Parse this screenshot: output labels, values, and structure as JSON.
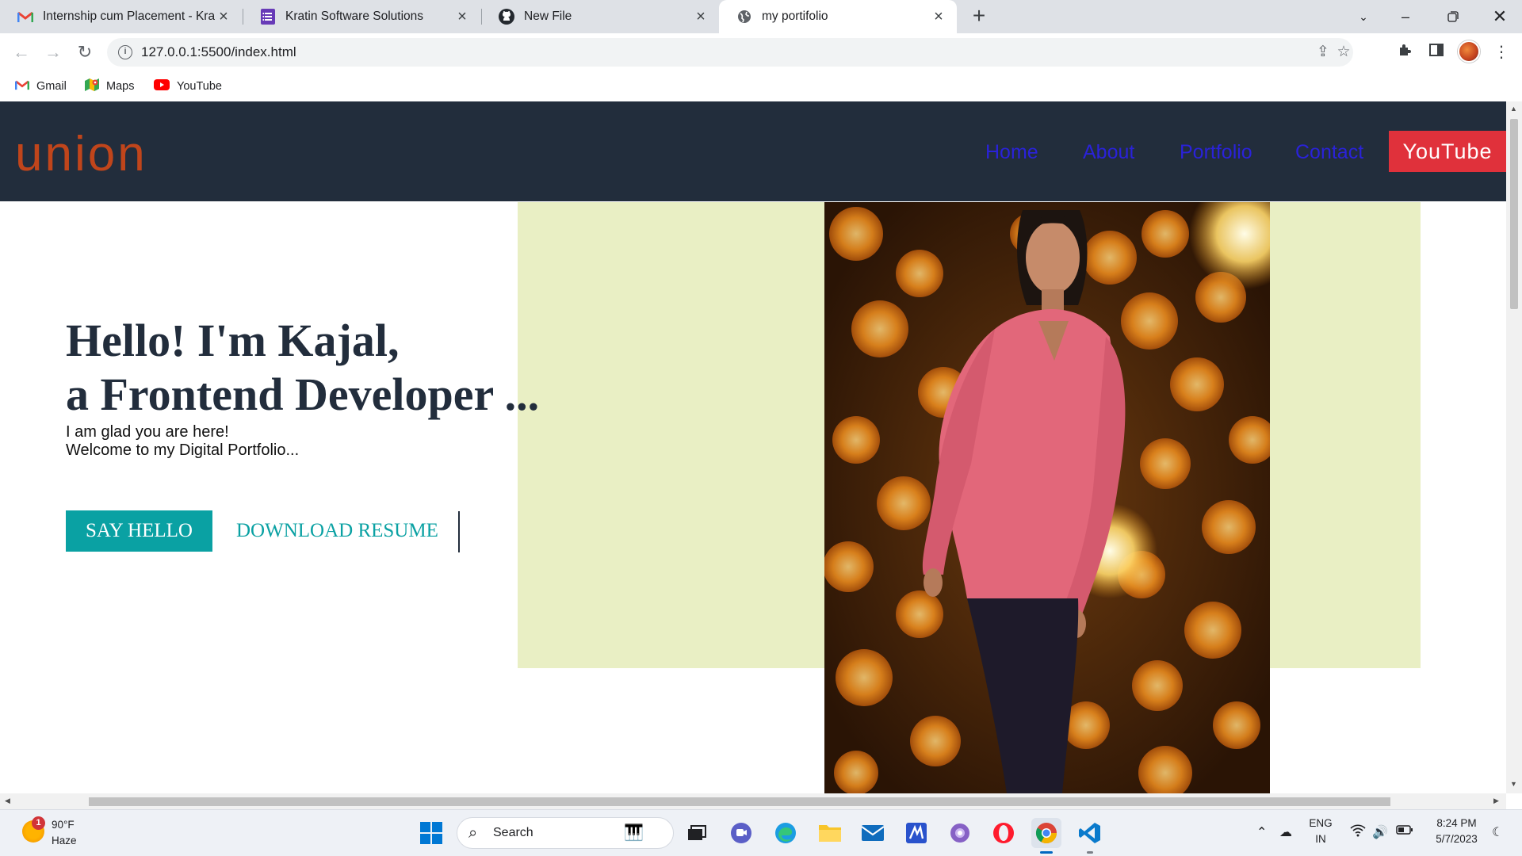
{
  "browser": {
    "tabs": [
      {
        "title": "Internship cum Placement - Krati",
        "favicon": "gmail-icon"
      },
      {
        "title": "Kratin Software Solutions",
        "favicon": "forms-icon"
      },
      {
        "title": "New File",
        "favicon": "github-icon"
      },
      {
        "title": "my portifolio",
        "favicon": "globe-icon",
        "active": true
      }
    ],
    "url": "127.0.0.1:5500/index.html",
    "bookmarks": [
      {
        "label": "Gmail",
        "icon": "gmail-icon"
      },
      {
        "label": "Maps",
        "icon": "maps-icon"
      },
      {
        "label": "YouTube",
        "icon": "youtube-icon"
      }
    ]
  },
  "site": {
    "logo": "union",
    "nav": {
      "home": "Home",
      "about": "About",
      "portfolio": "Portfolio",
      "contact": "Contact",
      "youtube": "YouTube"
    },
    "hero": {
      "heading_line1": "Hello! I'm Kajal,",
      "heading_line2": "a Frontend Developer ...",
      "sub_line1": "I am glad you are here!",
      "sub_line2": "Welcome to my Digital Portfolio...",
      "say_hello": "SAY HELLO",
      "download_resume": "DOWNLOAD RESUME"
    },
    "colors": {
      "nav_bg": "#222d3c",
      "logo": "#c0451b",
      "nav_link": "#2a22d9",
      "youtube_btn": "#e0313b",
      "accent": "#0aa1a3",
      "hero_bg": "#e9efc4"
    }
  },
  "taskbar": {
    "weather": {
      "temp": "90°F",
      "condition": "Haze",
      "badge": "1"
    },
    "search_label": "Search",
    "lang_top": "ENG",
    "lang_bottom": "IN",
    "time": "8:24 PM",
    "date": "5/7/2023"
  }
}
